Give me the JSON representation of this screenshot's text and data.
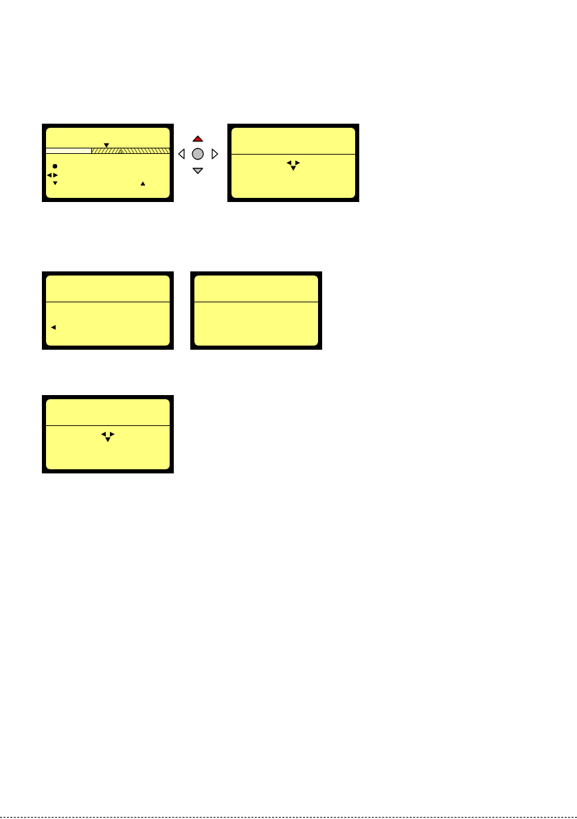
{
  "rows": [
    {
      "items": [
        {
          "kind": "timeline"
        },
        {
          "kind": "dpad",
          "buttons": [
            {
              "kind": "up",
              "color": "#e60000"
            },
            {
              "kind": "left",
              "color": "#ffffff"
            },
            {
              "kind": "center",
              "color": "#c0c0c0"
            },
            {
              "kind": "right",
              "color": "#ffffff"
            },
            {
              "kind": "down",
              "color": "#c0c0c0"
            }
          ]
        },
        {
          "kind": "navigate"
        }
      ]
    },
    {
      "items": [
        {
          "kind": "back"
        },
        {
          "kind": "plain"
        }
      ]
    },
    {
      "items": [
        {
          "kind": "navigate"
        }
      ]
    }
  ]
}
